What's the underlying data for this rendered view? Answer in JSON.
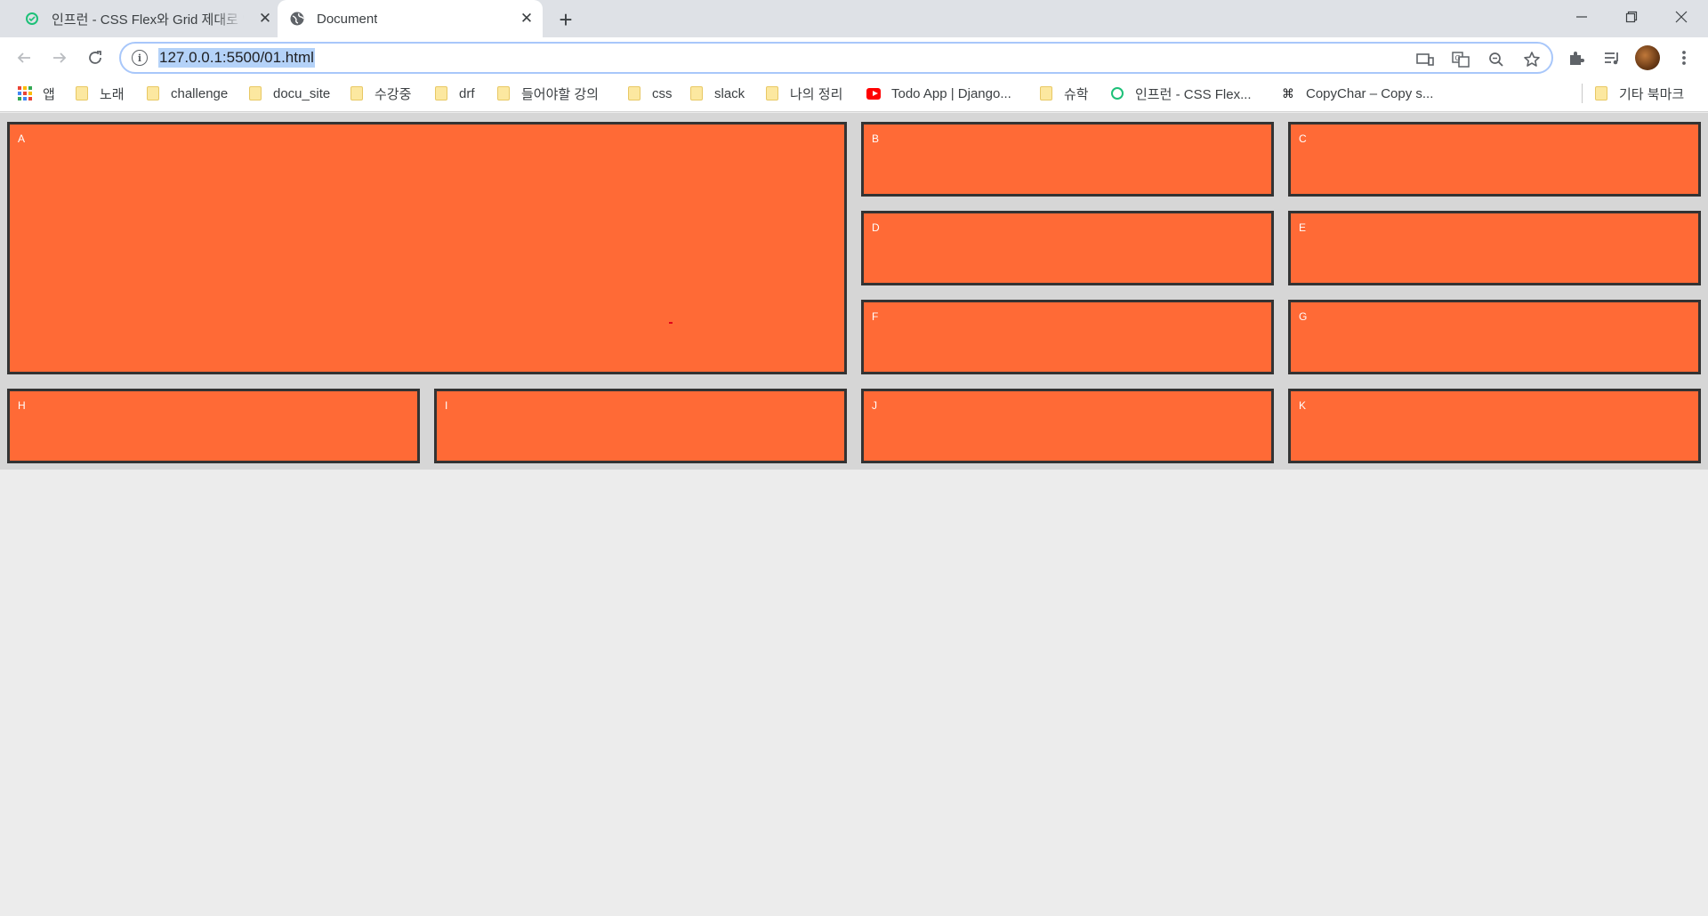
{
  "browser": {
    "tabs": [
      {
        "title": "인프런 - CSS Flex와 Grid 제대로 익히기",
        "active": false,
        "favicon": "inflearn-icon"
      },
      {
        "title": "Document",
        "active": true,
        "favicon": "globe-icon"
      }
    ],
    "new_tab_label": "+",
    "window_controls": {
      "minimize": "─",
      "restore": "❐",
      "close": "✕"
    },
    "address": {
      "url": "127.0.0.1:5500/01.html",
      "selected": true
    },
    "bookmarks": [
      {
        "label": "앱",
        "icon": "apps-icon"
      },
      {
        "label": "노래",
        "icon": "folder-icon"
      },
      {
        "label": "challenge",
        "icon": "folder-icon"
      },
      {
        "label": "docu_site",
        "icon": "folder-icon"
      },
      {
        "label": "수강중",
        "icon": "folder-icon"
      },
      {
        "label": "drf",
        "icon": "folder-icon"
      },
      {
        "label": "들어야할 강의",
        "icon": "folder-icon"
      },
      {
        "label": "css",
        "icon": "folder-icon"
      },
      {
        "label": "slack",
        "icon": "folder-icon"
      },
      {
        "label": "나의 정리",
        "icon": "folder-icon"
      },
      {
        "label": "Todo App | Django...",
        "icon": "youtube-icon"
      },
      {
        "label": "슈학",
        "icon": "folder-icon"
      },
      {
        "label": "인프런 - CSS Flex...",
        "icon": "inflearn-icon"
      },
      {
        "label": "CopyChar – Copy s...",
        "icon": "command-icon"
      },
      {
        "label": "기타 북마크",
        "icon": "folder-icon"
      }
    ]
  },
  "grid_items": [
    "A",
    "B",
    "C",
    "D",
    "E",
    "F",
    "G",
    "H",
    "I",
    "J",
    "K"
  ],
  "colors": {
    "item_bg": "#ff6a36",
    "item_border": "#333333",
    "container_bg": "#d6d6d6",
    "page_bg": "#ececec",
    "address_highlight": "#b4d2f8"
  }
}
